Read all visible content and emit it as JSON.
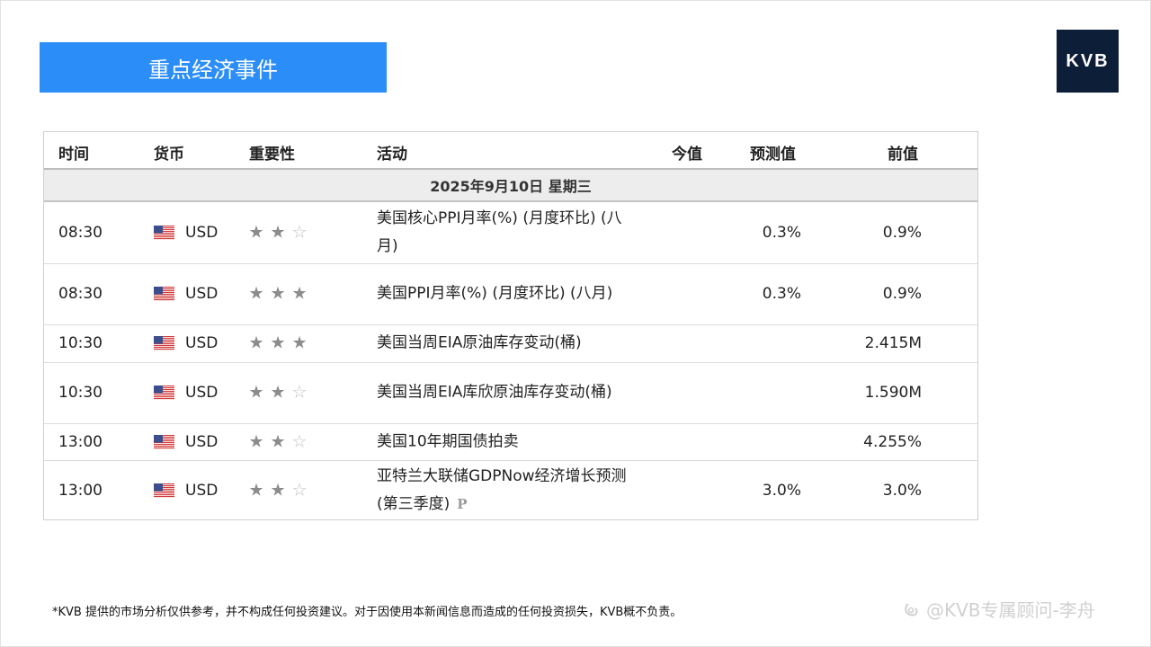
{
  "banner": {
    "title": "重点经济事件"
  },
  "logo": {
    "text": "KVB"
  },
  "table": {
    "headers": {
      "time": "时间",
      "currency": "货币",
      "importance": "重要性",
      "activity": "活动",
      "actual": "今值",
      "forecast": "预测值",
      "previous": "前值"
    },
    "date_label": "2025年9月10日  星期三",
    "rows": [
      {
        "time": "08:30",
        "currency": "USD",
        "flag": "us-flag-icon",
        "stars": 2,
        "activity": "美国核心PPI月率(%) (月度环比) (八月)",
        "actual": "",
        "forecast": "0.3%",
        "previous": "0.9%"
      },
      {
        "time": "08:30",
        "currency": "USD",
        "flag": "us-flag-icon",
        "stars": 3,
        "activity": "美国PPI月率(%) (月度环比) (八月)",
        "actual": "",
        "forecast": "0.3%",
        "previous": "0.9%"
      },
      {
        "time": "10:30",
        "currency": "USD",
        "flag": "us-flag-icon",
        "stars": 3,
        "activity": "美国当周EIA原油库存变动(桶)",
        "actual": "",
        "forecast": "",
        "previous": "2.415M"
      },
      {
        "time": "10:30",
        "currency": "USD",
        "flag": "us-flag-icon",
        "stars": 2,
        "activity": "美国当周EIA库欣原油库存变动(桶)",
        "actual": "",
        "forecast": "",
        "previous": "1.590M"
      },
      {
        "time": "13:00",
        "currency": "USD",
        "flag": "us-flag-icon",
        "stars": 2,
        "activity": "美国10年期国债拍卖",
        "actual": "",
        "forecast": "",
        "previous": "4.255%"
      },
      {
        "time": "13:00",
        "currency": "USD",
        "flag": "us-flag-icon",
        "stars": 2,
        "activity": "亚特兰大联储GDPNow经济增长预测 (第三季度)",
        "badge": "P",
        "actual": "",
        "forecast": "3.0%",
        "previous": "3.0%"
      }
    ]
  },
  "footer": {
    "disclaimer": "*KVB 提供的市场分析仅供参考，并不构成任何投资建议。对于因使用本新闻信息而造成的任何投资损失，KVB概不负责。",
    "watermark": "@KVB专属顾问-李舟"
  }
}
